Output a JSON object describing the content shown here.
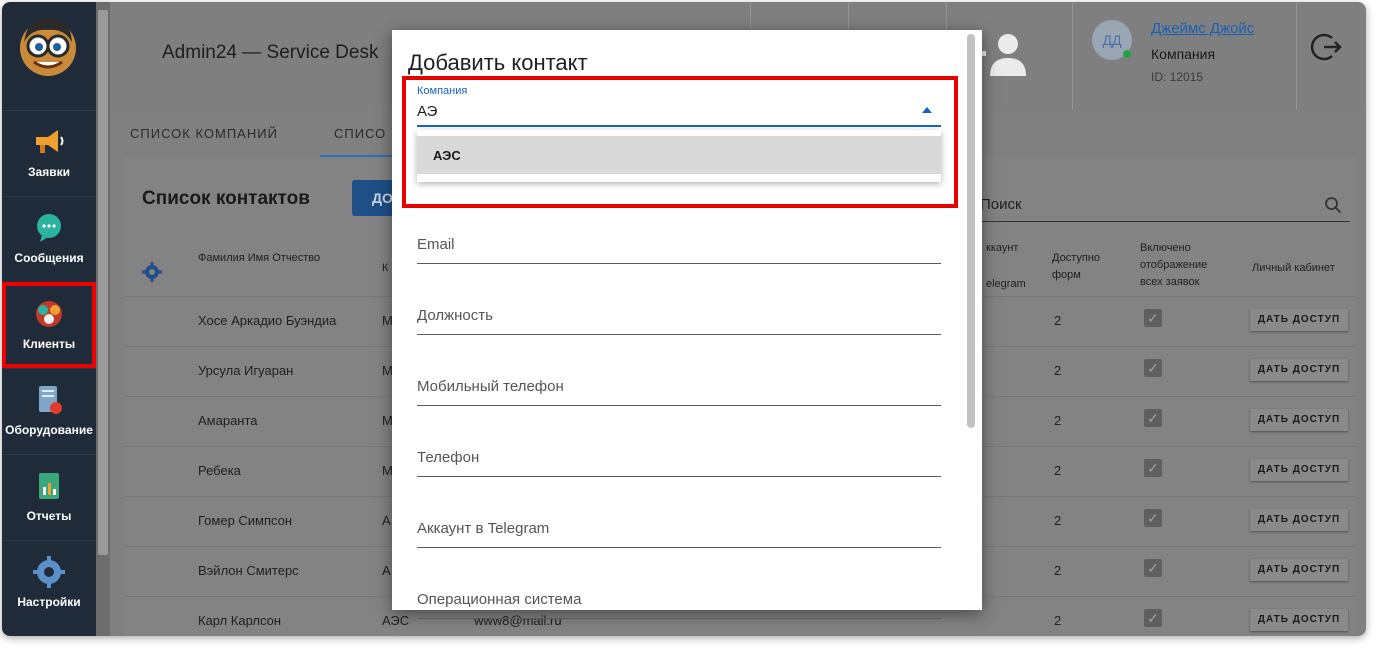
{
  "app": {
    "title": "Admin24 — Service Desk"
  },
  "sidebar": {
    "items": [
      {
        "label": "Заявки",
        "icon": "megaphone-icon"
      },
      {
        "label": "Сообщения",
        "icon": "chat-bubble-icon"
      },
      {
        "label": "Клиенты",
        "icon": "clients-icon"
      },
      {
        "label": "Оборудование",
        "icon": "equipment-icon"
      },
      {
        "label": "Отчеты",
        "icon": "report-icon"
      },
      {
        "label": "Настройки",
        "icon": "gear-icon"
      }
    ],
    "active": "Клиенты"
  },
  "header": {
    "user_initials": "ДД",
    "user_name": "Джеймс Джойс",
    "company": "Компания",
    "user_id": "ID: 12015"
  },
  "tabs": [
    {
      "label": "СПИСОК КОМПАНИЙ"
    },
    {
      "label": "СПИСО"
    }
  ],
  "card": {
    "title": "Список контактов",
    "add_label": "ДО",
    "search_placeholder": "Поиск",
    "columns": {
      "fio": "Фамилия Имя Отчество",
      "company_short": "К",
      "telegram_top": "ккаунт",
      "telegram_bottom": "elegram",
      "forms_l1": "Доступно",
      "forms_l2": "форм",
      "display_l1": "Включено",
      "display_l2": "отображение",
      "display_l3": "всех заявок",
      "cabinet": "Личный кабинет"
    },
    "rows": [
      {
        "name": "Хосе Аркадио Буэндиа",
        "company": "М",
        "email": "",
        "forms": "2",
        "access": "ДАТЬ ДОСТУП"
      },
      {
        "name": "Урсула Игуаран",
        "company": "М",
        "email": "",
        "forms": "2",
        "access": "ДАТЬ ДОСТУП"
      },
      {
        "name": "Амаранта",
        "company": "М",
        "email": "",
        "forms": "2",
        "access": "ДАТЬ ДОСТУП"
      },
      {
        "name": "Ребека",
        "company": "М",
        "email": "",
        "forms": "2",
        "access": "ДАТЬ ДОСТУП"
      },
      {
        "name": "Гомер Симпсон",
        "company": "А",
        "email": "",
        "forms": "2",
        "access": "ДАТЬ ДОСТУП"
      },
      {
        "name": "Вэйлон Смитерс",
        "company": "А",
        "email": "",
        "forms": "2",
        "access": "ДАТЬ ДОСТУП"
      },
      {
        "name": "Карл Карлсон",
        "company": "АЭС",
        "email": "www8@mail.ru",
        "forms": "2",
        "access": "ДАТЬ ДОСТУП"
      }
    ]
  },
  "modal": {
    "title": "Добавить контакт",
    "company_label": "Компания",
    "company_value": "АЭ",
    "dropdown_option": "АЭС",
    "fields": [
      "Email",
      "Должность",
      "Мобильный телефон",
      "Телефон",
      "Аккаунт в Telegram",
      "Операционная система"
    ]
  }
}
